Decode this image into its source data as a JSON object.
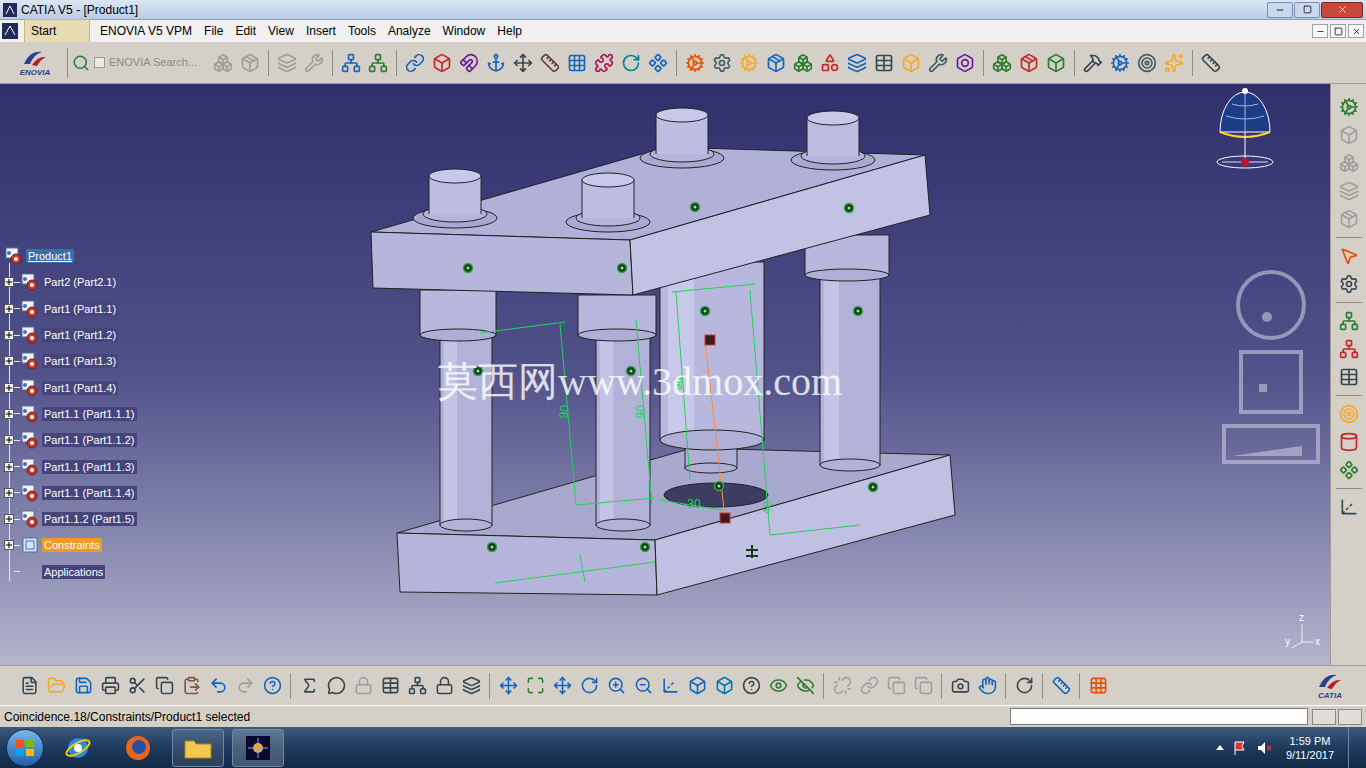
{
  "window": {
    "title": "CATIA V5 - [Product1]"
  },
  "menu": [
    {
      "label": "Start",
      "selected": true
    },
    {
      "label": "ENOVIA V5 VPM",
      "selected": false
    },
    {
      "label": "File",
      "selected": false
    },
    {
      "label": "Edit",
      "selected": false
    },
    {
      "label": "View",
      "selected": false
    },
    {
      "label": "Insert",
      "selected": false
    },
    {
      "label": "Tools",
      "selected": false
    },
    {
      "label": "Analyze",
      "selected": false
    },
    {
      "label": "Window",
      "selected": false
    },
    {
      "label": "Help",
      "selected": false
    }
  ],
  "toolbar": {
    "logo": "ENOVIA",
    "search": {
      "placeholder": "ENOVIA Search...",
      "checked": false
    }
  },
  "tree": [
    {
      "label": "Product1",
      "kind": "product",
      "selected": true
    },
    {
      "label": "Part2 (Part2.1)",
      "kind": "part",
      "selected": false
    },
    {
      "label": "Part1 (Part1.1)",
      "kind": "part",
      "selected": false
    },
    {
      "label": "Part1 (Part1.2)",
      "kind": "part",
      "selected": false
    },
    {
      "label": "Part1 (Part1.3)",
      "kind": "part",
      "selected": false
    },
    {
      "label": "Part1 (Part1.4)",
      "kind": "part",
      "selected": false
    },
    {
      "label": "Part1.1 (Part1.1.1)",
      "kind": "part",
      "selected": false
    },
    {
      "label": "Part1.1 (Part1.1.2)",
      "kind": "part",
      "selected": false
    },
    {
      "label": "Part1.1 (Part1.1.3)",
      "kind": "part",
      "selected": false
    },
    {
      "label": "Part1.1 (Part1.1.4)",
      "kind": "part",
      "selected": false
    },
    {
      "label": "Part1.1.2 (Part1.5)",
      "kind": "part",
      "selected": false
    },
    {
      "label": "Constraints",
      "kind": "constraints",
      "selected": true
    },
    {
      "label": "Applications",
      "kind": "applications",
      "selected": false
    }
  ],
  "watermark": "莫西网www.3dmox.com",
  "dimensions": [
    {
      "value": "90"
    },
    {
      "value": "90"
    },
    {
      "value": "90"
    },
    {
      "value": "-30"
    },
    {
      "value": "40"
    }
  ],
  "axes": [
    "z",
    "y",
    "x"
  ],
  "brand": "CATIA",
  "status_bar": {
    "message": "Coincidence.18/Constraints/Product1 selected"
  },
  "taskbar": {
    "time": "1:59 PM",
    "date": "9/11/2017"
  }
}
